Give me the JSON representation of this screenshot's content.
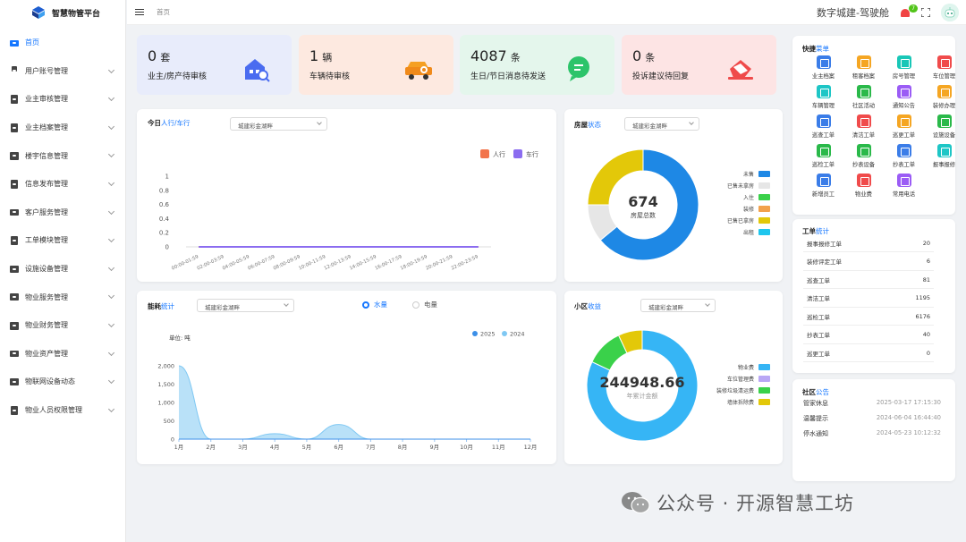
{
  "app": {
    "name": "智慧物管平台"
  },
  "header": {
    "breadcrumb": "首页",
    "title": "数字城建-驾驶舱",
    "notification_count": "7"
  },
  "sidebar": {
    "items": [
      {
        "label": "首页",
        "icon": "dashboard-icon",
        "active": true
      },
      {
        "label": "用户账号管理",
        "icon": "user-icon"
      },
      {
        "label": "业主审核管理",
        "icon": "audit-icon"
      },
      {
        "label": "业主档案管理",
        "icon": "archive-icon"
      },
      {
        "label": "楼宇信息管理",
        "icon": "building-icon"
      },
      {
        "label": "信息发布管理",
        "icon": "publish-icon"
      },
      {
        "label": "客户服务管理",
        "icon": "service-icon"
      },
      {
        "label": "工单模块管理",
        "icon": "workorder-icon"
      },
      {
        "label": "设施设备管理",
        "icon": "facility-icon"
      },
      {
        "label": "物业服务管理",
        "icon": "property-service-icon"
      },
      {
        "label": "物业财务管理",
        "icon": "finance-icon"
      },
      {
        "label": "物业资产管理",
        "icon": "asset-icon"
      },
      {
        "label": "物联网设备动态",
        "icon": "iot-icon"
      },
      {
        "label": "物业人员权限管理",
        "icon": "permission-icon"
      }
    ]
  },
  "stats": [
    {
      "value": "0",
      "unit": "套",
      "label": "业主/房产待审核",
      "bg": "#e8ecfb",
      "icon": "house-search-icon"
    },
    {
      "value": "1",
      "unit": "辆",
      "label": "车辆待审核",
      "bg": "#fde9e0",
      "icon": "car-icon"
    },
    {
      "value": "4087",
      "unit": "条",
      "label": "生日/节日消息待发送",
      "bg": "#e4f6ec",
      "icon": "message-icon"
    },
    {
      "value": "0",
      "unit": "条",
      "label": "投诉建议待回复",
      "bg": "#fde4e4",
      "icon": "complaint-icon"
    }
  ],
  "traffic": {
    "title_prefix": "今日",
    "title_highlight": "人行/车行",
    "select": "城建彩金湖畔",
    "legend": [
      {
        "name": "人行",
        "color": "#f2744b"
      },
      {
        "name": "车行",
        "color": "#8b6cf0"
      }
    ],
    "chart_data": {
      "type": "line",
      "x": [
        "00:00-01:59",
        "02:00-03:59",
        "04:00-05:59",
        "06:00-07:59",
        "08:00-09:59",
        "10:00-11:59",
        "12:00-13:59",
        "14:00-15:59",
        "16:00-17:59",
        "18:00-19:59",
        "20:00-21:59",
        "22:00-23:59"
      ],
      "series": [
        {
          "name": "人行",
          "values": [
            0,
            0,
            0,
            0,
            0,
            0,
            0,
            0,
            0,
            0,
            0,
            0
          ]
        },
        {
          "name": "车行",
          "values": [
            0,
            0,
            0,
            0,
            0,
            0,
            0,
            0,
            0,
            0,
            0,
            0
          ]
        }
      ],
      "y_ticks": [
        "1",
        "0.8",
        "0.6",
        "0.4",
        "0.2",
        "0"
      ],
      "ylim": [
        0,
        1
      ]
    }
  },
  "house": {
    "title": "房屋",
    "title_highlight": "状态",
    "select": "城建彩金湖畔",
    "center_value": "674",
    "center_label": "房屋总数",
    "chart_data": {
      "type": "pie",
      "labels": [
        "未售",
        "已售未拿房",
        "入住",
        "装修",
        "已售已拿房",
        "出租"
      ],
      "values": [
        64,
        11,
        0,
        0,
        25,
        0
      ],
      "colors": [
        "#1e88e5",
        "#e6e6e6",
        "#3ad14a",
        "#f2a14b",
        "#e3c809",
        "#1ec6ee"
      ]
    }
  },
  "energy": {
    "title": "能耗",
    "title_highlight": "统计",
    "select": "城建彩金湖畔",
    "radio": [
      {
        "label": "水量",
        "checked": true
      },
      {
        "label": "电量",
        "checked": false
      }
    ],
    "unit": "单位: 吨",
    "chart_data": {
      "type": "area",
      "x": [
        "1月",
        "2月",
        "3月",
        "4月",
        "5月",
        "6月",
        "7月",
        "8月",
        "9月",
        "10月",
        "11月",
        "12月"
      ],
      "series": [
        {
          "name": "2025",
          "color": "#3b8fe8",
          "values": [
            0,
            0,
            0,
            0,
            0,
            0,
            0,
            0,
            0,
            0,
            0,
            0
          ]
        },
        {
          "name": "2024",
          "color": "#7fc8f3",
          "values": [
            2000,
            0,
            0,
            150,
            0,
            400,
            0,
            0,
            0,
            0,
            0,
            0
          ]
        }
      ],
      "y_ticks": [
        "2,000",
        "1,500",
        "1,000",
        "500",
        "0"
      ],
      "ylim": [
        0,
        2000
      ]
    }
  },
  "revenue": {
    "title": "小区",
    "title_highlight": "收益",
    "select": "城建彩金湖畔",
    "center_value": "244948.66",
    "center_label": "年累计金额",
    "chart_data": {
      "type": "pie",
      "labels": [
        "物业费",
        "车位管理费",
        "装修垃圾清运费",
        "墙体拆除费"
      ],
      "values": [
        82,
        0,
        11,
        7
      ],
      "colors": [
        "#36b5f5",
        "#b9a7f5",
        "#3ad14a",
        "#e3c809"
      ]
    }
  },
  "quick": {
    "title": "快捷",
    "title_highlight": "菜单",
    "items": [
      {
        "label": "业主档案",
        "color": "#3b7de8"
      },
      {
        "label": "租客档案",
        "color": "#f5a623"
      },
      {
        "label": "房号管理",
        "color": "#19c7b7"
      },
      {
        "label": "车位管理",
        "color": "#f04b4b"
      },
      {
        "label": "车辆管理",
        "color": "#1ec6c6"
      },
      {
        "label": "社区活动",
        "color": "#2ab94a"
      },
      {
        "label": "通知公告",
        "color": "#9b5cf5"
      },
      {
        "label": "装修办理",
        "color": "#f5a623"
      },
      {
        "label": "巡查工单",
        "color": "#3b7de8"
      },
      {
        "label": "清洁工单",
        "color": "#f04b4b"
      },
      {
        "label": "巡更工单",
        "color": "#f5a623"
      },
      {
        "label": "设施设备",
        "color": "#2ab94a"
      },
      {
        "label": "巡检工单",
        "color": "#2ab94a"
      },
      {
        "label": "抄表设备",
        "color": "#2ab94a"
      },
      {
        "label": "抄表工单",
        "color": "#3b7de8"
      },
      {
        "label": "报事报修",
        "color": "#1ec6c6"
      },
      {
        "label": "新增员工",
        "color": "#3b7de8"
      },
      {
        "label": "物业费",
        "color": "#f04b4b"
      },
      {
        "label": "常用电话",
        "color": "#9b5cf5"
      }
    ]
  },
  "workorders": {
    "title": "工单",
    "title_highlight": "统计",
    "rows": [
      {
        "name": "报事报修工单",
        "count": "20"
      },
      {
        "name": "装修评定工单",
        "count": "6"
      },
      {
        "name": "巡查工单",
        "count": "81"
      },
      {
        "name": "清洁工单",
        "count": "1195"
      },
      {
        "name": "巡检工单",
        "count": "6176"
      },
      {
        "name": "抄表工单",
        "count": "40"
      },
      {
        "name": "巡更工单",
        "count": "0"
      }
    ]
  },
  "notices": {
    "title": "社区",
    "title_highlight": "公告",
    "rows": [
      {
        "name": "管家休息",
        "time": "2025-03-17 17:15:30"
      },
      {
        "name": "温馨提示",
        "time": "2024-06-04 16:44:40"
      },
      {
        "name": "停水通知",
        "time": "2024-05-23 10:12:32"
      }
    ]
  },
  "watermark": {
    "text": "公众号 · 开源智慧工坊"
  }
}
